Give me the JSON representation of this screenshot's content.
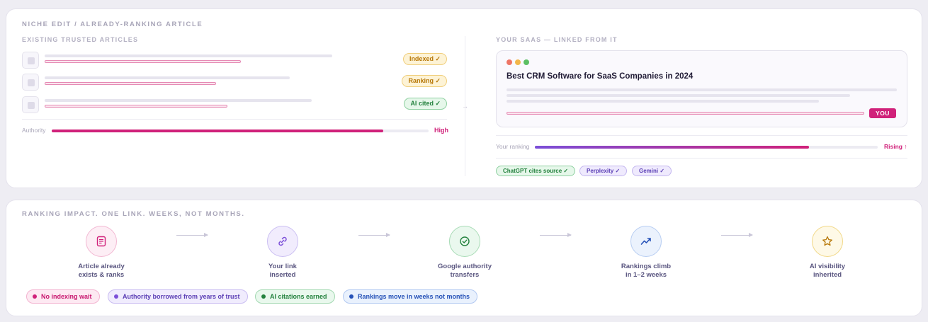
{
  "top_panel": {
    "title": "NICHE EDIT / ALREADY-RANKING ARTICLE",
    "left": {
      "title": "EXISTING TRUSTED ARTICLES",
      "articles": [
        {
          "badge": "Indexed ✓"
        },
        {
          "badge": "Ranking ✓"
        },
        {
          "badge": "AI cited ✓"
        }
      ],
      "authority_label": "Authority",
      "authority_value_label": "High",
      "authority_level_percent": 88
    },
    "connector": "→",
    "right": {
      "title": "YOUR SAAS — LINKED FROM IT",
      "browser_title": "Best CRM Software for SaaS Companies in 2024",
      "you_badge": "YOU",
      "ranking_label": "Your ranking",
      "ranking_value_label": "Rising ↑",
      "ranking_level_percent": 80,
      "ai_pills": [
        "ChatGPT cites source ✓",
        "Perplexity ✓",
        "Gemini ✓"
      ]
    }
  },
  "bottom_panel": {
    "title": "RANKING IMPACT. ONE LINK. WEEKS, NOT MONTHS.",
    "steps": [
      {
        "line1": "Article already",
        "line2": "exists & ranks",
        "icon": "document-icon"
      },
      {
        "line1": "Your link",
        "line2": "inserted",
        "icon": "link-icon"
      },
      {
        "line1": "Google authority",
        "line2": "transfers",
        "icon": "check-circle-icon"
      },
      {
        "line1": "Rankings climb",
        "line2": "in 1–2 weeks",
        "icon": "trending-up-icon"
      },
      {
        "line1": "AI visibility",
        "line2": "inherited",
        "icon": "star-icon"
      }
    ],
    "tags": [
      "No indexing wait",
      "Authority borrowed from years of trust",
      "AI citations earned",
      "Rankings move in weeks not months"
    ]
  },
  "colors": {
    "pink": "#d0217a",
    "purple": "#7b4fd8",
    "green": "#23813d",
    "blue": "#2652b8",
    "amber": "#b77809"
  }
}
